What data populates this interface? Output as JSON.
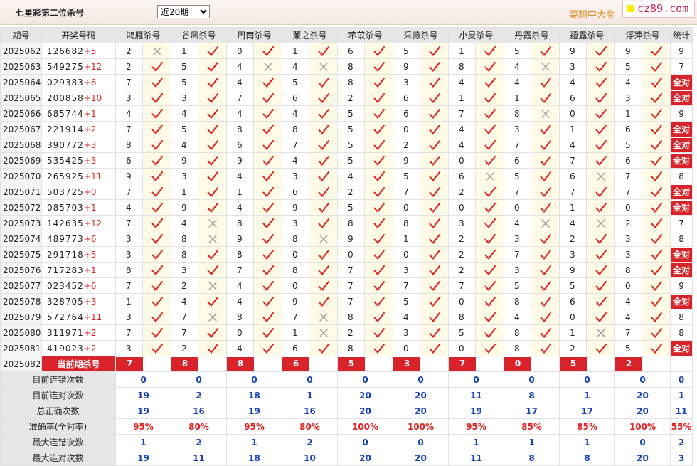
{
  "header": {
    "title": "七星彩第二位杀号",
    "period_select": "近20期",
    "slogan": "要想中大奖",
    "logo": "cz89.com"
  },
  "columns": {
    "period": "期号",
    "draw": "开奖号码",
    "experts": [
      "鸿雁杀号",
      "谷风杀号",
      "周南杀号",
      "蒹之杀号",
      "芣苡杀号",
      "采薇杀号",
      "小旻杀号",
      "丹霞杀号",
      "蕴露杀号",
      "浮萍杀号"
    ],
    "stat": "统计"
  },
  "rows": [
    {
      "period": "2025062",
      "draw": "126682",
      "add": "+5",
      "preds": [
        {
          "v": "2",
          "ok": false
        },
        {
          "v": "1",
          "ok": true
        },
        {
          "v": "0",
          "ok": true
        },
        {
          "v": "1",
          "ok": true
        },
        {
          "v": "6",
          "ok": true
        },
        {
          "v": "5",
          "ok": true
        },
        {
          "v": "1",
          "ok": true
        },
        {
          "v": "5",
          "ok": true
        },
        {
          "v": "9",
          "ok": true
        },
        {
          "v": "9",
          "ok": true
        }
      ],
      "stat": "9"
    },
    {
      "period": "2025063",
      "draw": "549275",
      "add": "+12",
      "preds": [
        {
          "v": "2",
          "ok": true
        },
        {
          "v": "5",
          "ok": true
        },
        {
          "v": "4",
          "ok": false
        },
        {
          "v": "4",
          "ok": false
        },
        {
          "v": "8",
          "ok": true
        },
        {
          "v": "9",
          "ok": true
        },
        {
          "v": "8",
          "ok": true
        },
        {
          "v": "4",
          "ok": false
        },
        {
          "v": "3",
          "ok": true
        },
        {
          "v": "5",
          "ok": true
        }
      ],
      "stat": "7"
    },
    {
      "period": "2025064",
      "draw": "029383",
      "add": "+6",
      "preds": [
        {
          "v": "7",
          "ok": true
        },
        {
          "v": "5",
          "ok": true
        },
        {
          "v": "4",
          "ok": true
        },
        {
          "v": "5",
          "ok": true
        },
        {
          "v": "8",
          "ok": true
        },
        {
          "v": "3",
          "ok": true
        },
        {
          "v": "4",
          "ok": true
        },
        {
          "v": "4",
          "ok": true
        },
        {
          "v": "4",
          "ok": true
        },
        {
          "v": "4",
          "ok": true
        }
      ],
      "stat": "全对"
    },
    {
      "period": "2025065",
      "draw": "200858",
      "add": "+10",
      "preds": [
        {
          "v": "3",
          "ok": true
        },
        {
          "v": "3",
          "ok": true
        },
        {
          "v": "7",
          "ok": true
        },
        {
          "v": "6",
          "ok": true
        },
        {
          "v": "2",
          "ok": true
        },
        {
          "v": "6",
          "ok": true
        },
        {
          "v": "1",
          "ok": true
        },
        {
          "v": "1",
          "ok": true
        },
        {
          "v": "6",
          "ok": true
        },
        {
          "v": "3",
          "ok": true
        }
      ],
      "stat": "全对"
    },
    {
      "period": "2025066",
      "draw": "685744",
      "add": "+1",
      "preds": [
        {
          "v": "4",
          "ok": true
        },
        {
          "v": "4",
          "ok": true
        },
        {
          "v": "4",
          "ok": true
        },
        {
          "v": "4",
          "ok": true
        },
        {
          "v": "5",
          "ok": true
        },
        {
          "v": "6",
          "ok": true
        },
        {
          "v": "7",
          "ok": true
        },
        {
          "v": "8",
          "ok": false
        },
        {
          "v": "0",
          "ok": true
        },
        {
          "v": "1",
          "ok": true
        }
      ],
      "stat": "9"
    },
    {
      "period": "2025067",
      "draw": "221914",
      "add": "+2",
      "preds": [
        {
          "v": "7",
          "ok": true
        },
        {
          "v": "5",
          "ok": true
        },
        {
          "v": "8",
          "ok": true
        },
        {
          "v": "8",
          "ok": true
        },
        {
          "v": "5",
          "ok": true
        },
        {
          "v": "0",
          "ok": true
        },
        {
          "v": "4",
          "ok": true
        },
        {
          "v": "3",
          "ok": true
        },
        {
          "v": "1",
          "ok": true
        },
        {
          "v": "6",
          "ok": true
        }
      ],
      "stat": "全对"
    },
    {
      "period": "2025068",
      "draw": "390772",
      "add": "+3",
      "preds": [
        {
          "v": "8",
          "ok": true
        },
        {
          "v": "4",
          "ok": true
        },
        {
          "v": "6",
          "ok": true
        },
        {
          "v": "7",
          "ok": true
        },
        {
          "v": "5",
          "ok": true
        },
        {
          "v": "2",
          "ok": true
        },
        {
          "v": "4",
          "ok": true
        },
        {
          "v": "7",
          "ok": true
        },
        {
          "v": "4",
          "ok": true
        },
        {
          "v": "5",
          "ok": true
        }
      ],
      "stat": "全对"
    },
    {
      "period": "2025069",
      "draw": "535425",
      "add": "+3",
      "preds": [
        {
          "v": "6",
          "ok": true
        },
        {
          "v": "9",
          "ok": true
        },
        {
          "v": "9",
          "ok": true
        },
        {
          "v": "4",
          "ok": true
        },
        {
          "v": "5",
          "ok": true
        },
        {
          "v": "9",
          "ok": true
        },
        {
          "v": "0",
          "ok": true
        },
        {
          "v": "6",
          "ok": true
        },
        {
          "v": "7",
          "ok": true
        },
        {
          "v": "6",
          "ok": true
        }
      ],
      "stat": "全对"
    },
    {
      "period": "2025070",
      "draw": "265925",
      "add": "+11",
      "preds": [
        {
          "v": "9",
          "ok": true
        },
        {
          "v": "3",
          "ok": true
        },
        {
          "v": "4",
          "ok": true
        },
        {
          "v": "3",
          "ok": true
        },
        {
          "v": "4",
          "ok": true
        },
        {
          "v": "5",
          "ok": true
        },
        {
          "v": "6",
          "ok": false
        },
        {
          "v": "5",
          "ok": true
        },
        {
          "v": "6",
          "ok": false
        },
        {
          "v": "7",
          "ok": true
        }
      ],
      "stat": "8"
    },
    {
      "period": "2025071",
      "draw": "503725",
      "add": "+0",
      "preds": [
        {
          "v": "7",
          "ok": true
        },
        {
          "v": "1",
          "ok": true
        },
        {
          "v": "1",
          "ok": true
        },
        {
          "v": "6",
          "ok": true
        },
        {
          "v": "2",
          "ok": true
        },
        {
          "v": "7",
          "ok": true
        },
        {
          "v": "2",
          "ok": true
        },
        {
          "v": "7",
          "ok": true
        },
        {
          "v": "7",
          "ok": true
        },
        {
          "v": "7",
          "ok": true
        }
      ],
      "stat": "全对"
    },
    {
      "period": "2025072",
      "draw": "085703",
      "add": "+1",
      "preds": [
        {
          "v": "4",
          "ok": true
        },
        {
          "v": "9",
          "ok": true
        },
        {
          "v": "4",
          "ok": true
        },
        {
          "v": "9",
          "ok": true
        },
        {
          "v": "5",
          "ok": true
        },
        {
          "v": "0",
          "ok": true
        },
        {
          "v": "0",
          "ok": true
        },
        {
          "v": "0",
          "ok": true
        },
        {
          "v": "1",
          "ok": true
        },
        {
          "v": "0",
          "ok": true
        }
      ],
      "stat": "全对"
    },
    {
      "period": "2025073",
      "draw": "142635",
      "add": "+12",
      "preds": [
        {
          "v": "7",
          "ok": true
        },
        {
          "v": "4",
          "ok": false
        },
        {
          "v": "8",
          "ok": true
        },
        {
          "v": "3",
          "ok": true
        },
        {
          "v": "8",
          "ok": true
        },
        {
          "v": "8",
          "ok": true
        },
        {
          "v": "3",
          "ok": true
        },
        {
          "v": "4",
          "ok": false
        },
        {
          "v": "4",
          "ok": false
        },
        {
          "v": "2",
          "ok": true
        }
      ],
      "stat": "7"
    },
    {
      "period": "2025074",
      "draw": "489773",
      "add": "+6",
      "preds": [
        {
          "v": "3",
          "ok": true
        },
        {
          "v": "8",
          "ok": false
        },
        {
          "v": "9",
          "ok": true
        },
        {
          "v": "8",
          "ok": false
        },
        {
          "v": "9",
          "ok": true
        },
        {
          "v": "1",
          "ok": true
        },
        {
          "v": "2",
          "ok": true
        },
        {
          "v": "3",
          "ok": true
        },
        {
          "v": "2",
          "ok": true
        },
        {
          "v": "3",
          "ok": true
        }
      ],
      "stat": "8"
    },
    {
      "period": "2025075",
      "draw": "291718",
      "add": "+5",
      "preds": [
        {
          "v": "3",
          "ok": true
        },
        {
          "v": "8",
          "ok": true
        },
        {
          "v": "8",
          "ok": true
        },
        {
          "v": "0",
          "ok": true
        },
        {
          "v": "0",
          "ok": true
        },
        {
          "v": "0",
          "ok": true
        },
        {
          "v": "2",
          "ok": true
        },
        {
          "v": "7",
          "ok": true
        },
        {
          "v": "3",
          "ok": true
        },
        {
          "v": "3",
          "ok": true
        }
      ],
      "stat": "全对"
    },
    {
      "period": "2025076",
      "draw": "717283",
      "add": "+1",
      "preds": [
        {
          "v": "8",
          "ok": true
        },
        {
          "v": "3",
          "ok": true
        },
        {
          "v": "7",
          "ok": true
        },
        {
          "v": "8",
          "ok": true
        },
        {
          "v": "7",
          "ok": true
        },
        {
          "v": "3",
          "ok": true
        },
        {
          "v": "2",
          "ok": true
        },
        {
          "v": "3",
          "ok": true
        },
        {
          "v": "9",
          "ok": true
        },
        {
          "v": "8",
          "ok": true
        }
      ],
      "stat": "全对"
    },
    {
      "period": "2025077",
      "draw": "023452",
      "add": "+6",
      "preds": [
        {
          "v": "7",
          "ok": true
        },
        {
          "v": "2",
          "ok": false
        },
        {
          "v": "4",
          "ok": true
        },
        {
          "v": "0",
          "ok": true
        },
        {
          "v": "7",
          "ok": true
        },
        {
          "v": "7",
          "ok": true
        },
        {
          "v": "7",
          "ok": true
        },
        {
          "v": "5",
          "ok": true
        },
        {
          "v": "5",
          "ok": true
        },
        {
          "v": "0",
          "ok": true
        }
      ],
      "stat": "9"
    },
    {
      "period": "2025078",
      "draw": "328705",
      "add": "+3",
      "preds": [
        {
          "v": "1",
          "ok": true
        },
        {
          "v": "4",
          "ok": true
        },
        {
          "v": "4",
          "ok": true
        },
        {
          "v": "9",
          "ok": true
        },
        {
          "v": "7",
          "ok": true
        },
        {
          "v": "5",
          "ok": true
        },
        {
          "v": "0",
          "ok": true
        },
        {
          "v": "8",
          "ok": true
        },
        {
          "v": "6",
          "ok": true
        },
        {
          "v": "4",
          "ok": true
        }
      ],
      "stat": "全对"
    },
    {
      "period": "2025079",
      "draw": "572764",
      "add": "+11",
      "preds": [
        {
          "v": "3",
          "ok": true
        },
        {
          "v": "7",
          "ok": false
        },
        {
          "v": "8",
          "ok": true
        },
        {
          "v": "7",
          "ok": false
        },
        {
          "v": "8",
          "ok": true
        },
        {
          "v": "4",
          "ok": true
        },
        {
          "v": "8",
          "ok": true
        },
        {
          "v": "4",
          "ok": true
        },
        {
          "v": "0",
          "ok": true
        },
        {
          "v": "4",
          "ok": true
        }
      ],
      "stat": "8"
    },
    {
      "period": "2025080",
      "draw": "311971",
      "add": "+2",
      "preds": [
        {
          "v": "7",
          "ok": true
        },
        {
          "v": "7",
          "ok": true
        },
        {
          "v": "0",
          "ok": true
        },
        {
          "v": "1",
          "ok": false
        },
        {
          "v": "2",
          "ok": true
        },
        {
          "v": "3",
          "ok": true
        },
        {
          "v": "5",
          "ok": true
        },
        {
          "v": "8",
          "ok": true
        },
        {
          "v": "1",
          "ok": false
        },
        {
          "v": "7",
          "ok": true
        }
      ],
      "stat": "8"
    },
    {
      "period": "2025081",
      "draw": "419023",
      "add": "+2",
      "preds": [
        {
          "v": "3",
          "ok": true
        },
        {
          "v": "2",
          "ok": true
        },
        {
          "v": "4",
          "ok": true
        },
        {
          "v": "6",
          "ok": true
        },
        {
          "v": "8",
          "ok": true
        },
        {
          "v": "0",
          "ok": true
        },
        {
          "v": "0",
          "ok": true
        },
        {
          "v": "8",
          "ok": true
        },
        {
          "v": "2",
          "ok": true
        },
        {
          "v": "5",
          "ok": true
        }
      ],
      "stat": "全对"
    }
  ],
  "current": {
    "period": "2025082",
    "label": "当前期杀号",
    "values": [
      "7",
      "8",
      "8",
      "6",
      "5",
      "3",
      "7",
      "0",
      "5",
      "2"
    ]
  },
  "stats": [
    {
      "label": "目前连错次数",
      "values": [
        "0",
        "0",
        "0",
        "0",
        "0",
        "0",
        "0",
        "0",
        "0",
        "0"
      ],
      "stat": "0"
    },
    {
      "label": "目前连对次数",
      "values": [
        "19",
        "2",
        "18",
        "1",
        "20",
        "20",
        "11",
        "8",
        "1",
        "20"
      ],
      "stat": "1"
    },
    {
      "label": "总正确次数",
      "values": [
        "19",
        "16",
        "19",
        "16",
        "20",
        "20",
        "19",
        "17",
        "17",
        "20"
      ],
      "stat": "11"
    },
    {
      "label": "准确率(全对率)",
      "values": [
        "95%",
        "80%",
        "95%",
        "80%",
        "100%",
        "100%",
        "95%",
        "85%",
        "85%",
        "100%"
      ],
      "stat": "55%",
      "rate": true
    },
    {
      "label": "最大连错次数",
      "values": [
        "1",
        "2",
        "1",
        "2",
        "0",
        "0",
        "1",
        "1",
        "1",
        "0"
      ],
      "stat": "2"
    },
    {
      "label": "最大连对次数",
      "values": [
        "19",
        "11",
        "18",
        "10",
        "20",
        "20",
        "11",
        "8",
        "8",
        "20"
      ],
      "stat": "3"
    }
  ],
  "icons": {
    "correct": "check-icon",
    "wrong": "cross-icon"
  },
  "colors": {
    "check": "#e11e1e",
    "cross": "#9a9a9a",
    "highlight": "#d9232a",
    "stat_blue": "#1640b8",
    "rate_red": "#e32020",
    "slogan": "#e08a1e",
    "logo": "#d21f4a"
  }
}
